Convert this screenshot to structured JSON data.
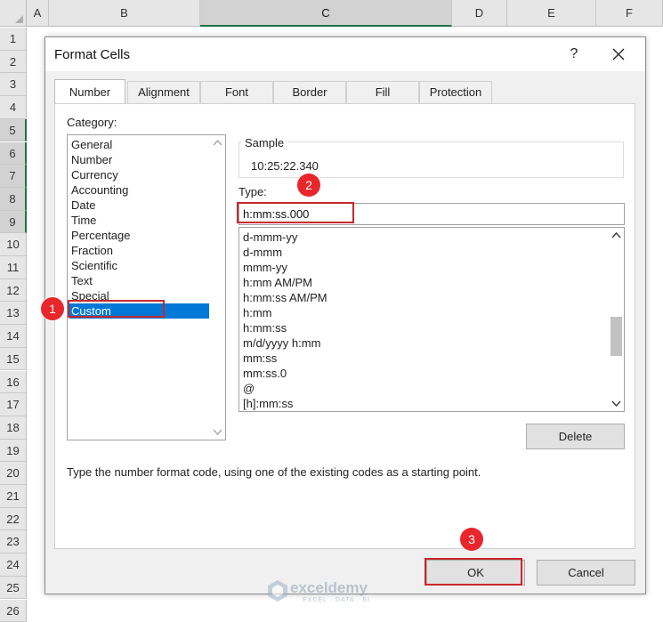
{
  "sheet": {
    "columns": [
      "A",
      "B",
      "C",
      "D",
      "E",
      "F"
    ],
    "selected_column": "C",
    "rows": [
      "1",
      "2",
      "3",
      "4",
      "5",
      "6",
      "7",
      "8",
      "9",
      "10",
      "11",
      "12",
      "13",
      "14",
      "15",
      "16",
      "17",
      "18",
      "19",
      "20",
      "21",
      "22",
      "23",
      "24",
      "25",
      "26"
    ],
    "selected_rows": [
      "5",
      "6",
      "7",
      "8",
      "9"
    ]
  },
  "dialog": {
    "title": "Format Cells",
    "help_label": "?",
    "close_icon": "close-icon",
    "tabs": [
      "Number",
      "Alignment",
      "Font",
      "Border",
      "Fill",
      "Protection"
    ],
    "active_tab": "Number"
  },
  "category": {
    "label": "Category:",
    "items": [
      "General",
      "Number",
      "Currency",
      "Accounting",
      "Date",
      "Time",
      "Percentage",
      "Fraction",
      "Scientific",
      "Text",
      "Special",
      "Custom"
    ],
    "selected": "Custom"
  },
  "sample": {
    "label": "Sample",
    "value": "10:25:22.340"
  },
  "type": {
    "label": "Type:",
    "value": "h:mm:ss.000",
    "list": [
      "d-mmm-yy",
      "d-mmm",
      "mmm-yy",
      "h:mm AM/PM",
      "h:mm:ss AM/PM",
      "h:mm",
      "h:mm:ss",
      "m/d/yyyy h:mm",
      "mm:ss",
      "mm:ss.0",
      "@",
      "[h]:mm:ss"
    ]
  },
  "buttons": {
    "delete": "Delete",
    "ok": "OK",
    "cancel": "Cancel"
  },
  "hint": "Type the number format code, using one of the existing codes as a starting point.",
  "annotations": {
    "step1": "1",
    "step2": "2",
    "step3": "3",
    "color": "#e8262c"
  },
  "watermark": {
    "name": "exceldemy",
    "tagline": "EXCEL · DATA · BI"
  },
  "colors": {
    "selection": "#0078d7",
    "excel_green": "#217346",
    "highlight": "#c8282d"
  }
}
